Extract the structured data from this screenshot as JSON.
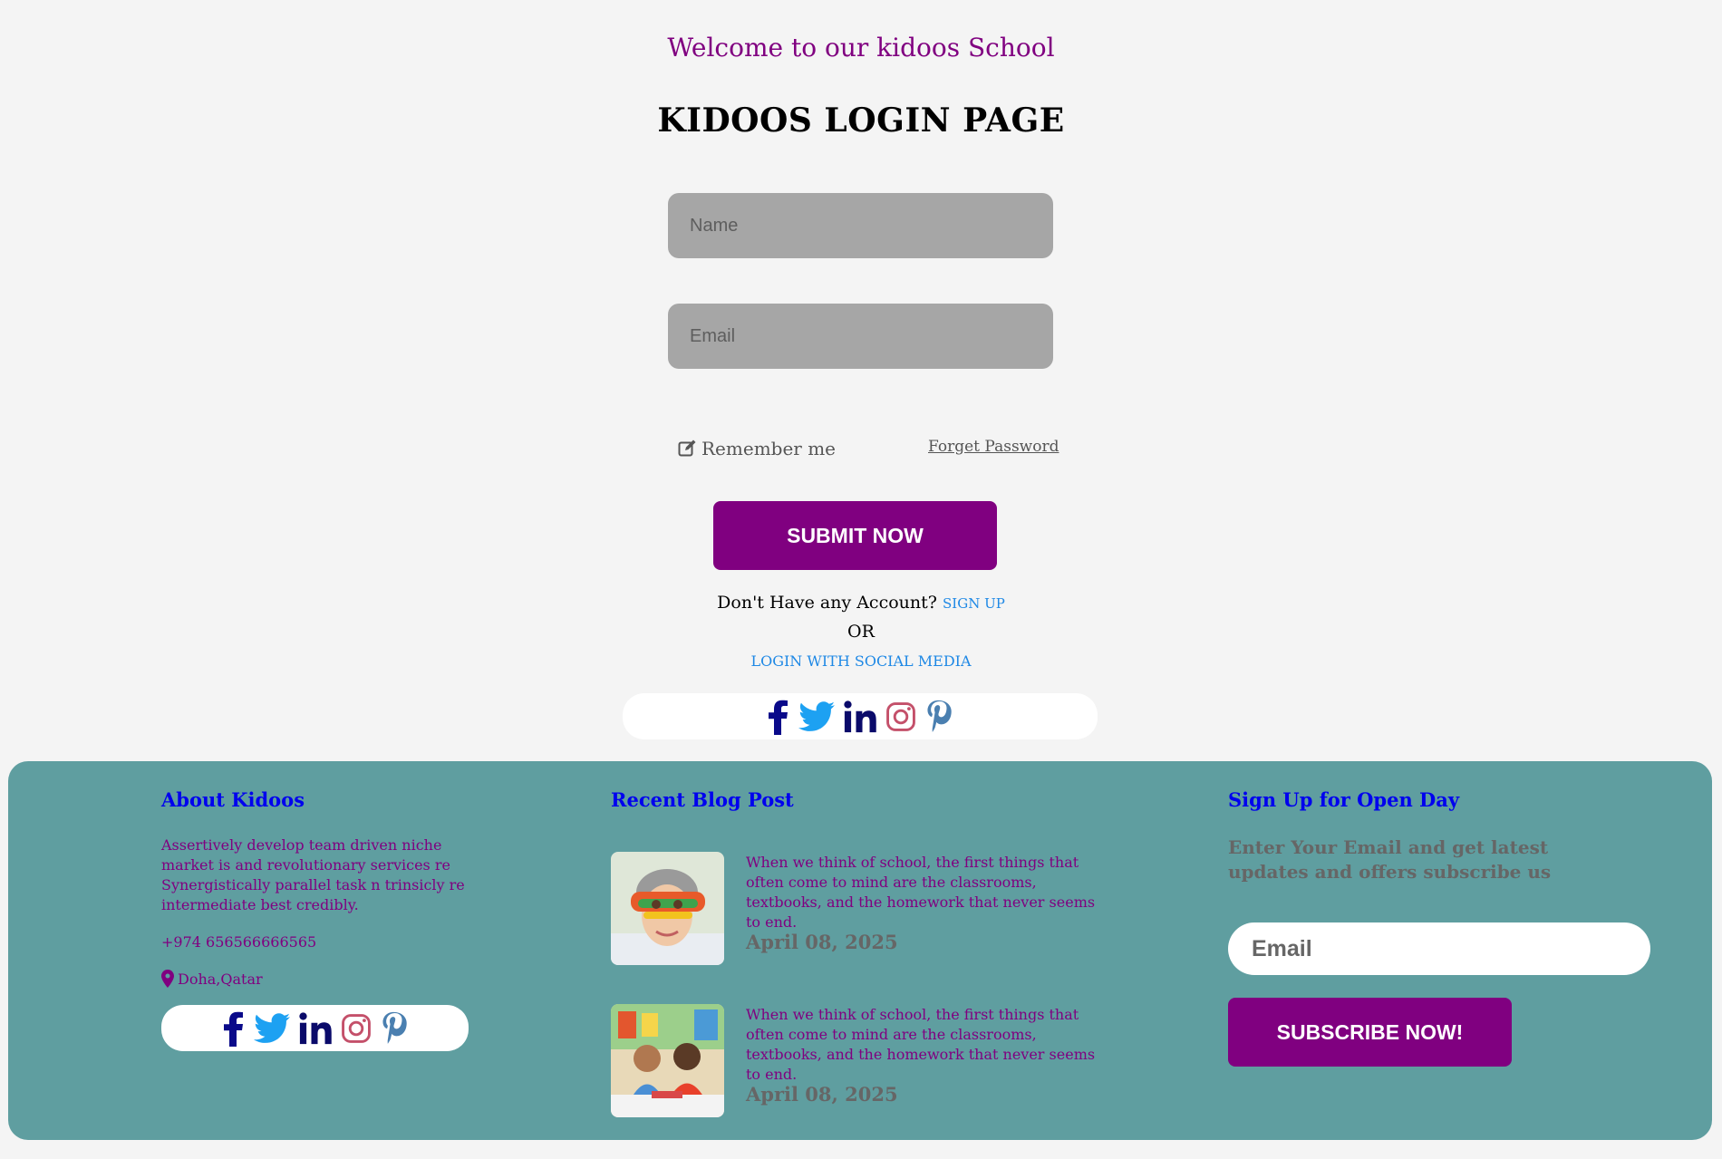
{
  "header": {
    "welcome": "Welcome to our kidoos School",
    "title": "KIDOOS LOGIN PAGE"
  },
  "form": {
    "name_placeholder": "Name",
    "email_placeholder": "Email",
    "remember_label": "Remember me",
    "forget_label": "Forget Password",
    "submit_label": "SUBMIT NOW",
    "no_account_text": "Don't Have any Account?",
    "signup_label": "SIGN UP",
    "or_text": "OR",
    "social_login_label": "LOGIN WITH SOCIAL MEDIA"
  },
  "social_icons": [
    "facebook-icon",
    "twitter-icon",
    "linkedin-icon",
    "instagram-icon",
    "pinterest-icon"
  ],
  "colors": {
    "brand_purple": "#800080",
    "footer_teal": "#5f9ea0",
    "link_blue": "#1e88e5",
    "heading_blue": "#0000ee"
  },
  "footer": {
    "about": {
      "heading": "About Kidoos",
      "text": "Assertively develop team driven niche market is and revolutionary services re Synergistically parallel task n trinsicly re intermediate best credibly.",
      "phone": "+974 656566666565",
      "location": "Doha,Qatar"
    },
    "blog": {
      "heading": "Recent Blog Post",
      "posts": [
        {
          "text": "When we think of school, the first things that often come to mind are the classrooms, textbooks, and the homework that never seems to end.",
          "date": "April 08, 2025"
        },
        {
          "text": "When we think of school, the first things that often come to mind are the classrooms, textbooks, and the homework that never seems to end.",
          "date": "April 08, 2025"
        }
      ]
    },
    "open_day": {
      "heading": "Sign Up for Open Day",
      "description": "Enter Your Email and get latest updates and offers subscribe us",
      "email_placeholder": "Email",
      "subscribe_label": "SUBSCRIBE NOW!"
    }
  }
}
